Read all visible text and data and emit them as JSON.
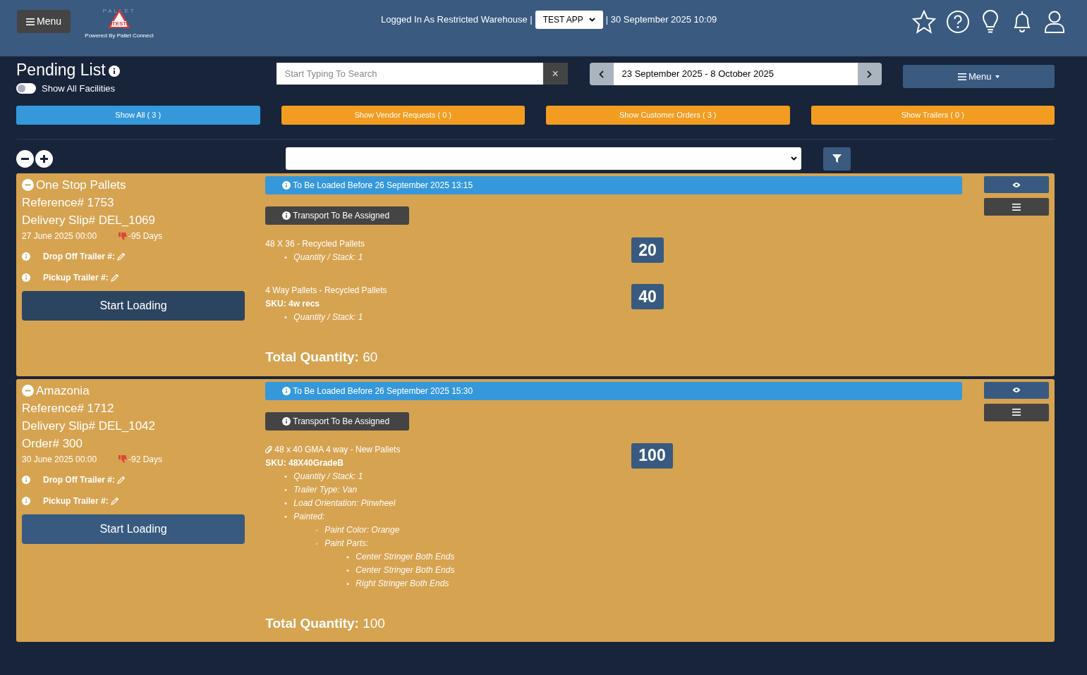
{
  "header": {
    "menu_button": "Menu",
    "logo_letters": "PALLET",
    "logo_text": "TEST",
    "logo_caption": "Powered By Pallet Connect",
    "login_text": "Logged In As Restricted Warehouse |",
    "app_select": "TEST APP",
    "datetime": "| 30 September 2025 10:09"
  },
  "toolbar": {
    "title": "Pending List",
    "toggle": {
      "label": "Show All Facilities",
      "on": false
    },
    "search": {
      "placeholder": "Start Typing To Search",
      "clear": "×"
    },
    "date_range": "23 September 2025 - 8 October 2025",
    "menu_button": "Menu"
  },
  "filters": [
    {
      "label": "Show All ( 3 )",
      "selected": true
    },
    {
      "label": "Show Vendor Requests ( 0 )",
      "selected": false
    },
    {
      "label": "Show Customer Orders ( 3 )",
      "selected": false
    },
    {
      "label": "Show Trailers ( 0 )",
      "selected": false
    }
  ],
  "orders": [
    {
      "expanded": true,
      "name": "One Stop Pallets",
      "lines": [
        "Reference# 1753",
        "Delivery Slip# DEL_1069"
      ],
      "date": "27 June 2025 00:00",
      "days": "-95 Days",
      "drop_off": "Drop Off Trailer #:",
      "pickup": "Pickup Trailer #:",
      "action": "Start Loading",
      "deadline": "To Be Loaded Before 26 September 2025 13:15",
      "transport": "Transport To Be Assigned",
      "items": [
        {
          "name": "48 X 36 - Recycled Pallets",
          "attachment": false,
          "properties": [
            {
              "marker": "•",
              "text": "Quantity / Stack: 1"
            }
          ],
          "quantity": "20"
        },
        {
          "name": "4 Way Pallets - Recycled Pallets",
          "attachment": false,
          "sku": "SKU: 4w recs",
          "properties": [
            {
              "marker": "•",
              "text": "Quantity / Stack: 1"
            }
          ],
          "quantity": "40"
        }
      ],
      "total": "Total Quantity:",
      "total_value": "60"
    },
    {
      "expanded": true,
      "name": "Amazonia",
      "lines": [
        "Reference# 1712",
        "Delivery Slip# DEL_1042",
        "Order# 300"
      ],
      "date": "30 June 2025 00:00",
      "days": "-92 Days",
      "drop_off": "Drop Off Trailer #:",
      "pickup": "Pickup Trailer #:",
      "action": "Start Loading",
      "deadline": "To Be Loaded Before 26 September 2025 15:30",
      "transport": "Transport To Be Assigned",
      "items": [
        {
          "name": "48 x 40 GMA 4 way - New Pallets",
          "attachment": true,
          "sku": "SKU: 48X40GradeB",
          "properties": [
            {
              "marker": "•",
              "text": "Quantity / Stack: 1"
            },
            {
              "marker": "•",
              "text": "Trailer Type: Van"
            },
            {
              "marker": "•",
              "text": "Load Orientation: Pinwheel"
            },
            {
              "marker": "•",
              "text": "Painted:",
              "children": [
                {
                  "marker": "◦",
                  "text": "Paint Color: Orange"
                },
                {
                  "marker": "◦",
                  "text": "Paint Parts:",
                  "children": [
                    {
                      "marker": "▪",
                      "text": "Center Stringer Both Ends"
                    },
                    {
                      "marker": "▪",
                      "text": "Center Stringer Both Ends"
                    },
                    {
                      "marker": "▪",
                      "text": "Right Stringer Both Ends"
                    }
                  ]
                }
              ]
            }
          ],
          "quantity": "100"
        }
      ],
      "total": "Total Quantity:",
      "total_value": "100"
    }
  ]
}
